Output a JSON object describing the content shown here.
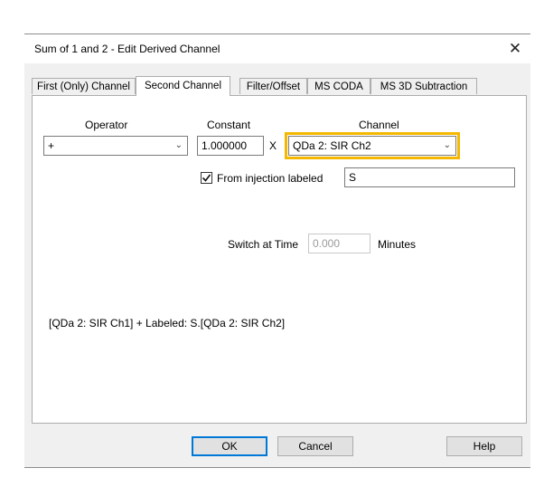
{
  "window": {
    "title": "Sum of 1 and 2 - Edit Derived Channel",
    "close_glyph": "✕"
  },
  "tabs": [
    {
      "label": "First (Only) Channel"
    },
    {
      "label": "Second Channel",
      "active": true
    },
    {
      "label": "Filter/Offset"
    },
    {
      "label": "MS CODA"
    },
    {
      "label": "MS 3D Subtraction"
    }
  ],
  "form": {
    "operator_label": "Operator",
    "operator_value": "+",
    "constant_label": "Constant",
    "constant_value": "1.000000",
    "multiply_sign": "X",
    "channel_label": "Channel",
    "channel_value": "QDa 2: SIR Ch2",
    "from_injection_checked": true,
    "from_injection_label": "From injection labeled",
    "injection_label_value": "S",
    "switch_label": "Switch at Time",
    "switch_value": "0.000",
    "minutes_label": "Minutes",
    "expression": "[QDa 2: SIR Ch1] + Labeled: S.[QDa 2: SIR Ch2]"
  },
  "buttons": {
    "ok": "OK",
    "cancel": "Cancel",
    "help": "Help"
  },
  "colors": {
    "highlight": "#f5b800",
    "default_button_border": "#0078d7",
    "panel_bg": "#ffffff",
    "dialog_bg": "#f0f0f0"
  },
  "icons": {
    "chevron": "chevron-down-icon",
    "check": "checkmark-icon",
    "close": "close-icon"
  }
}
